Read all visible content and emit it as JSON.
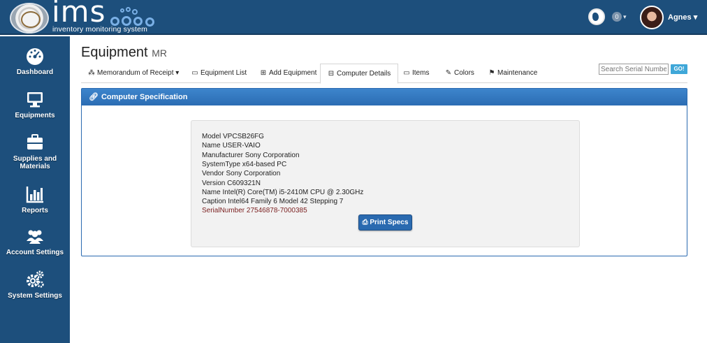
{
  "header": {
    "logo_text": "ims",
    "logo_subtitle": "inventory monitoring system",
    "notification_count": "0",
    "user_name": "Agnes"
  },
  "sidebar": {
    "items": [
      {
        "label": "Dashboard",
        "icon": "dashboard-icon"
      },
      {
        "label": "Equipments",
        "icon": "monitor-icon"
      },
      {
        "label": "Supplies and Materials",
        "icon": "briefcase-icon"
      },
      {
        "label": "Reports",
        "icon": "bar-chart-icon"
      },
      {
        "label": "Account Settings",
        "icon": "users-icon"
      },
      {
        "label": "System Settings",
        "icon": "gears-icon"
      }
    ]
  },
  "page": {
    "title": "Equipment",
    "subtitle": "MR"
  },
  "tabs": [
    {
      "label": "Memorandum of Receipt",
      "icon": "sitemap-icon",
      "dropdown": true
    },
    {
      "label": "Equipment List",
      "icon": "monitor-icon"
    },
    {
      "label": "Add Equipment",
      "icon": "plus-square-icon"
    },
    {
      "label": "Computer Details",
      "icon": "hdd-icon",
      "active": true
    },
    {
      "label": "Items",
      "icon": "laptop-icon"
    },
    {
      "label": "Colors",
      "icon": "brush-icon"
    },
    {
      "label": "Maintenance",
      "icon": "flag-icon"
    }
  ],
  "search": {
    "placeholder": "Search Serial Number",
    "button_label": "GO!"
  },
  "panel": {
    "title": "Computer Specification",
    "icon": "link-icon"
  },
  "specs": {
    "model": "Model VPCSB26FG",
    "name": "Name USER-VAIO",
    "manufacturer": "Manufacturer Sony Corporation",
    "system_type": "SystemType x64-based PC",
    "vendor": "Vendor Sony Corporation",
    "version": "Version C609321N",
    "cpu_name": "Name Intel(R) Core(TM) i5-2410M CPU @ 2.30GHz",
    "caption": "Caption Intel64 Family 6 Model 42 Stepping 7",
    "serial": "SerialNumber 27546878-7000385"
  },
  "print_button": {
    "label": "Print Specs",
    "icon": "print-icon"
  },
  "colors": {
    "topbar": "#1d4f7c",
    "panel_header": "#2b6db3",
    "serial_text": "#7a1f1f",
    "go_button": "#3fa7d8"
  }
}
